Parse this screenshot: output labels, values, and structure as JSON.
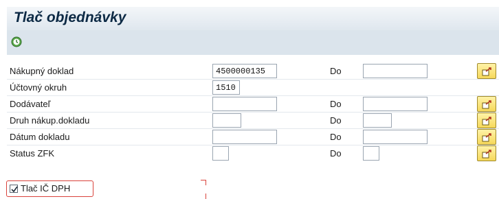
{
  "header": {
    "title": "Tlač objednávky"
  },
  "toolbar": {
    "execute_icon": "execute-clock-icon"
  },
  "rows": [
    {
      "label": "Nákupný doklad",
      "from_value": "4500000135",
      "has_to": true,
      "to_label": "Do",
      "to_value": ""
    },
    {
      "label": "Účtovný okruh",
      "from_value": "1510",
      "has_to": false
    },
    {
      "label": "Dodávateľ",
      "from_value": "",
      "has_to": true,
      "to_label": "Do",
      "to_value": ""
    },
    {
      "label": "Druh nákup.dokladu",
      "from_value": "",
      "has_to": true,
      "to_label": "Do",
      "to_value": ""
    },
    {
      "label": "Dátum dokladu",
      "from_value": "",
      "has_to": true,
      "to_label": "Do",
      "to_value": ""
    },
    {
      "label": "Status ZFK",
      "from_value": "",
      "has_to": true,
      "to_label": "Do",
      "to_value": ""
    }
  ],
  "checkbox": {
    "label": "Tlač IČ DPH",
    "checked": true
  },
  "colors": {
    "accent": "#d9413a",
    "select_button": "#f6d85a"
  }
}
